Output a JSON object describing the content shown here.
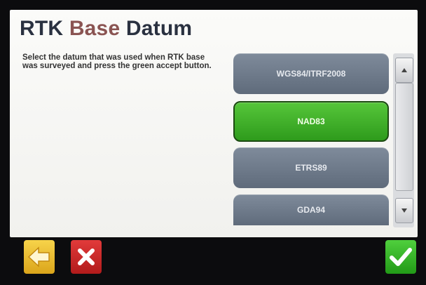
{
  "screen": {
    "title_part1": "RTK",
    "title_part2": "Base",
    "title_part3": "Datum",
    "instructions": "Select the datum that was used when RTK base was surveyed and press the green accept button."
  },
  "datum_list": {
    "selected": "NAD83",
    "items": [
      {
        "label": "WGS84/ITRF2008"
      },
      {
        "label": "NAD83"
      },
      {
        "label": "ETRS89"
      },
      {
        "label": "GDA94"
      }
    ]
  },
  "colors": {
    "selected_item": "#3fb52a",
    "unselected_item": "#6e7a8a",
    "back": "#f0c030",
    "cancel": "#d42a2a",
    "accept": "#3fbe30"
  },
  "icons": {
    "back": "arrow-left-icon",
    "cancel": "x-icon",
    "accept": "checkmark-icon",
    "scroll_up": "triangle-up-icon",
    "scroll_down": "triangle-down-icon"
  }
}
